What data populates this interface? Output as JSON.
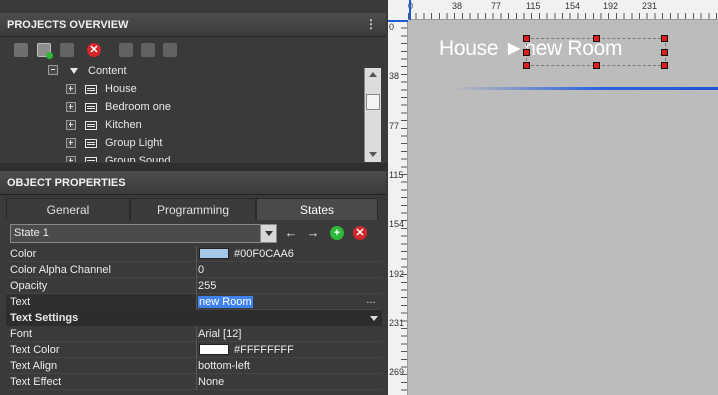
{
  "projects_overview": {
    "title": "PROJECTS OVERVIEW",
    "tree": {
      "root_label": "Content",
      "items": [
        {
          "label": "House"
        },
        {
          "label": "Bedroom one"
        },
        {
          "label": "Kitchen"
        },
        {
          "label": "Group Light"
        },
        {
          "label": "Group Sound"
        }
      ]
    }
  },
  "object_properties": {
    "title": "OBJECT PROPERTIES",
    "tabs": [
      {
        "label": "General",
        "active": false
      },
      {
        "label": "Programming",
        "active": false
      },
      {
        "label": "States",
        "active": true
      }
    ],
    "state_select": {
      "value": "State 1"
    },
    "properties": [
      {
        "name": "Color",
        "value": "#00F0CAA6",
        "swatch": "#a6c8ea"
      },
      {
        "name": "Color Alpha Channel",
        "value": "0"
      },
      {
        "name": "Opacity",
        "value": "255"
      },
      {
        "name": "Text",
        "value": "new Room",
        "selected": true,
        "ellipsis": "..."
      }
    ],
    "text_settings": {
      "group_label": "Text Settings",
      "properties": [
        {
          "name": "Font",
          "value": "Arial [12]"
        },
        {
          "name": "Text Color",
          "value": "#FFFFFFFF",
          "swatch": "#ffffff"
        },
        {
          "name": "Text Align",
          "value": "bottom-left"
        },
        {
          "name": "Text Effect",
          "value": "None"
        }
      ]
    }
  },
  "canvas": {
    "ruler_top_labels": [
      "0",
      "38",
      "77",
      "115",
      "154",
      "192",
      "231"
    ],
    "ruler_left_labels": [
      "0",
      "38",
      "77",
      "115",
      "154",
      "192",
      "231",
      "269"
    ],
    "text": "House ►new Room",
    "accent_color": "#1d5bd6",
    "handle_color": "#e31b1b"
  }
}
